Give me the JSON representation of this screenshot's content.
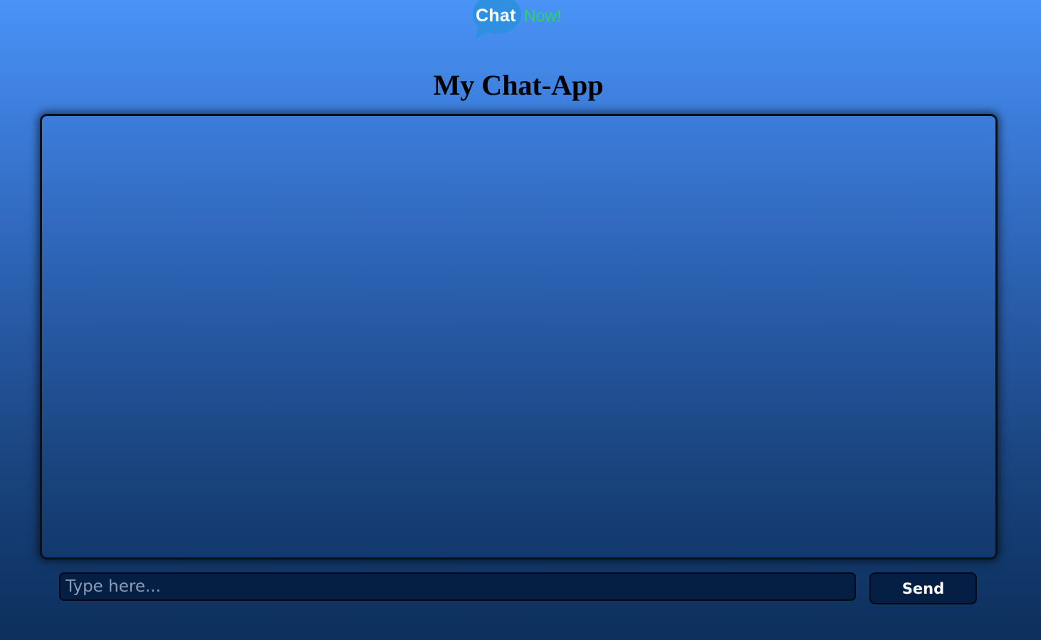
{
  "logo": {
    "part1": "Chat",
    "part2": "Now!",
    "bubble_color": "#2f8fe0",
    "part1_color": "#ffffff",
    "part2_color": "#2bd46a",
    "icon": "speech-bubble-icon"
  },
  "header": {
    "title": "My Chat-App"
  },
  "chat": {
    "messages": []
  },
  "composer": {
    "placeholder": "Type here...",
    "value": "",
    "send_label": "Send"
  },
  "colors": {
    "background_top": "#4a93f7",
    "background_bottom": "#0c2f5c",
    "input_background": "#041e44",
    "border": "#061120"
  }
}
